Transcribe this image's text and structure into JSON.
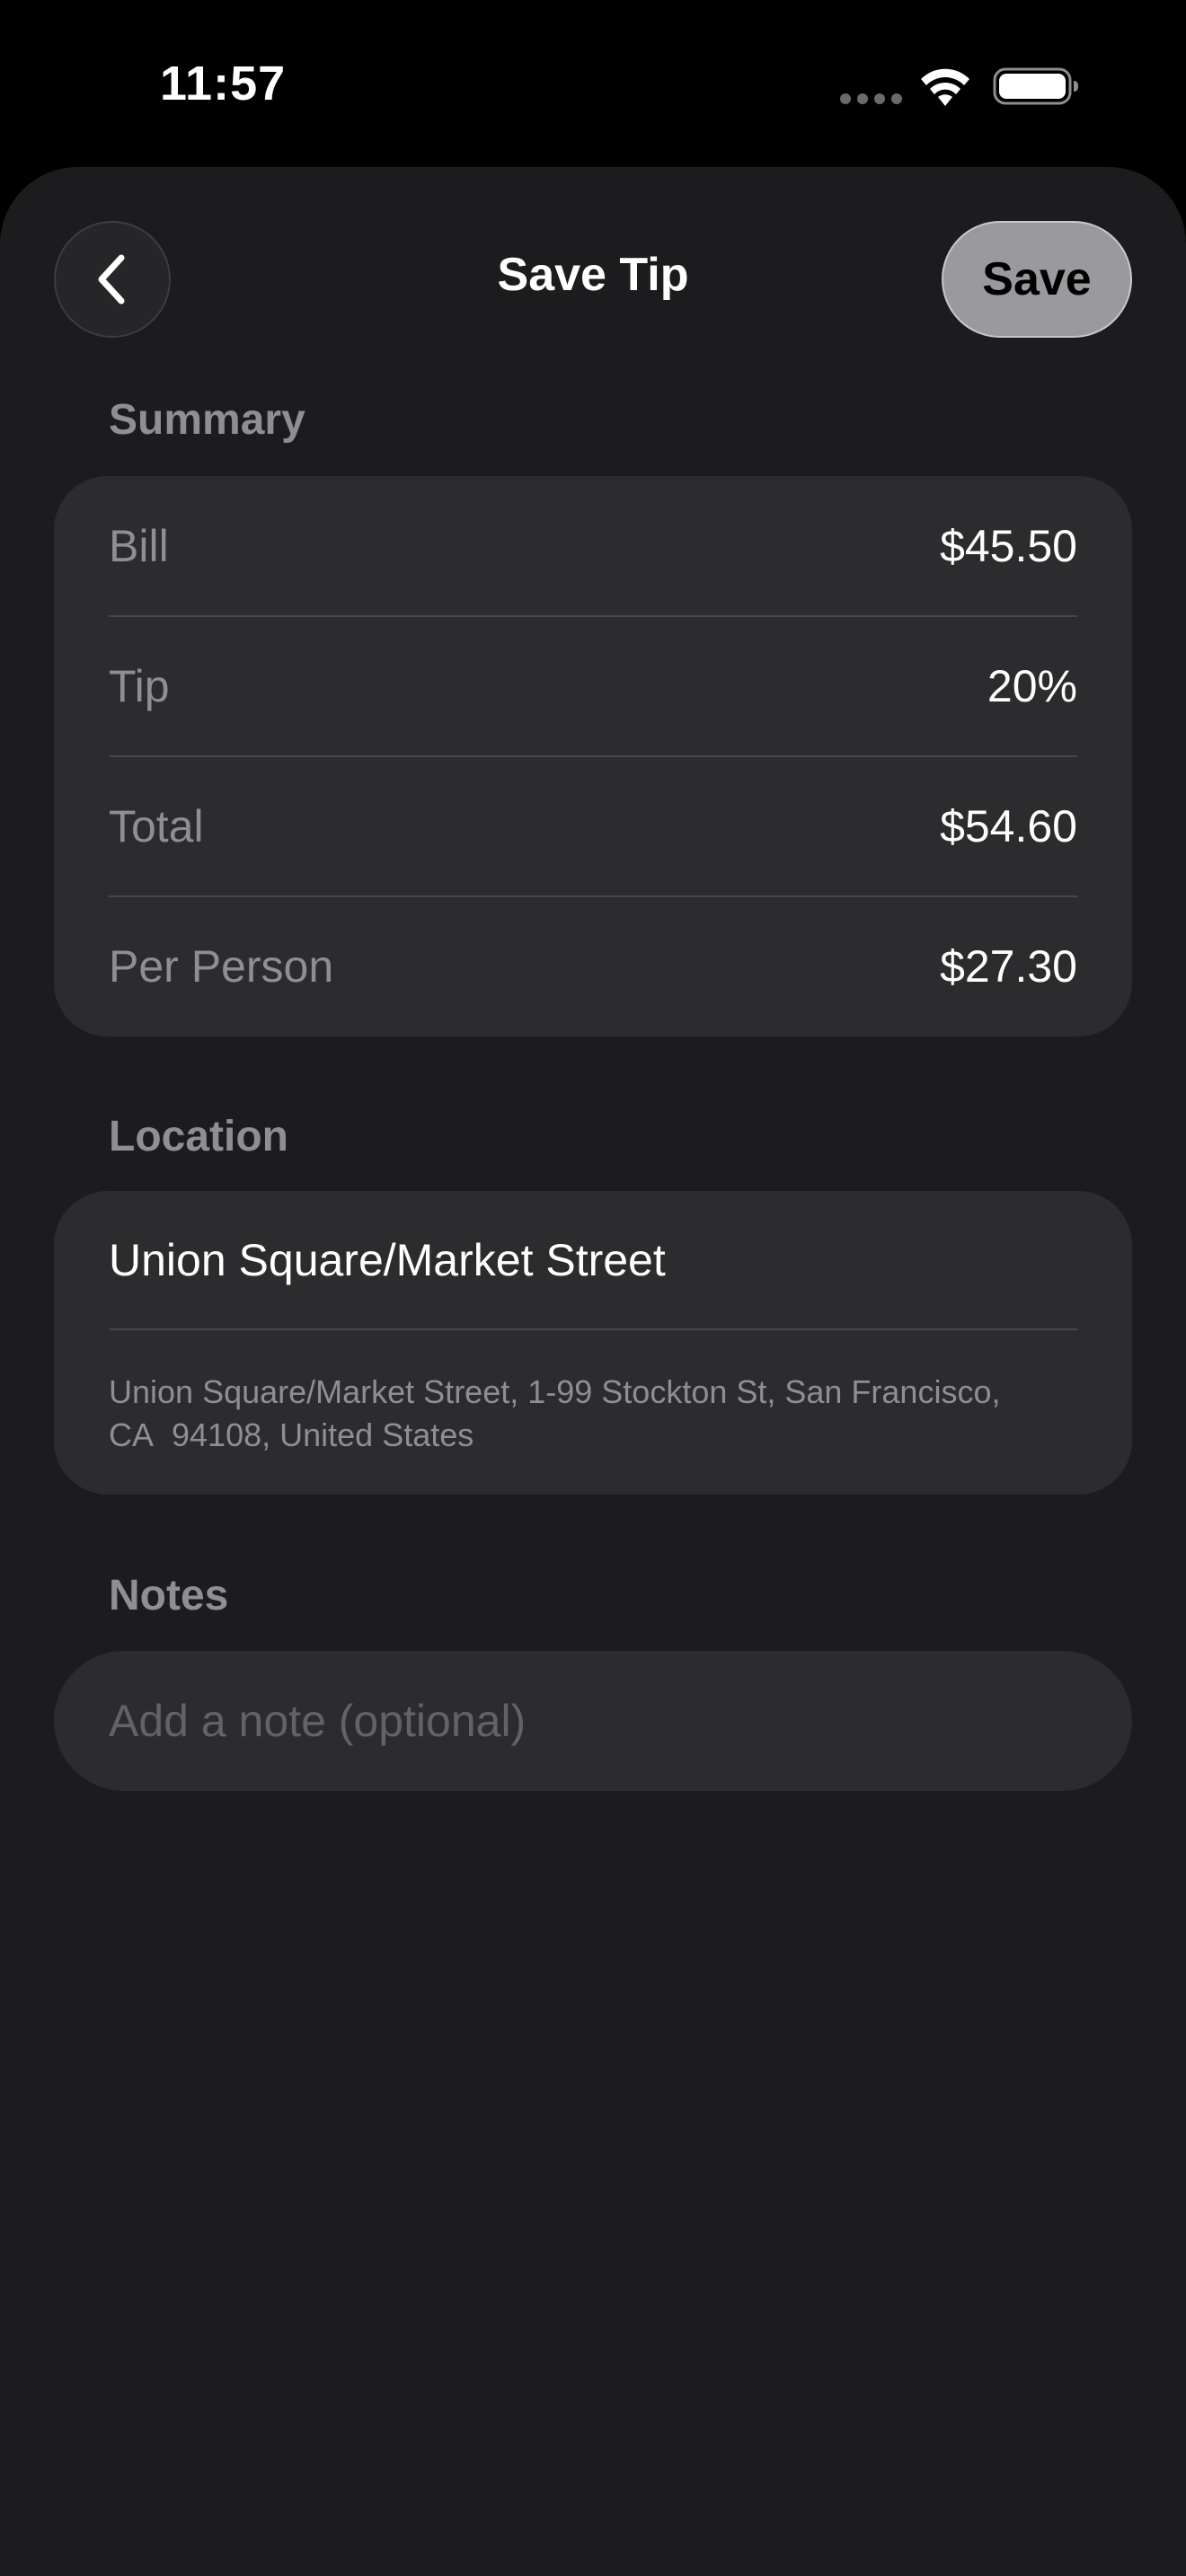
{
  "status_bar": {
    "time": "11:57",
    "icons": [
      "signal-dots-icon",
      "wifi-icon",
      "battery-icon"
    ]
  },
  "nav": {
    "back_icon": "chevron-left-icon",
    "title": "Save Tip",
    "save_label": "Save"
  },
  "summary": {
    "header": "Summary",
    "rows": [
      {
        "label": "Bill",
        "value": "$45.50"
      },
      {
        "label": "Tip",
        "value": "20%"
      },
      {
        "label": "Total",
        "value": "$54.60"
      },
      {
        "label": "Per Person",
        "value": "$27.30"
      }
    ]
  },
  "location": {
    "header": "Location",
    "name": "Union Square/Market Street",
    "address": "Union Square/Market Street, 1-99 Stockton St, San Francisco, CA  94108, United States"
  },
  "notes": {
    "header": "Notes",
    "value": "",
    "placeholder": "Add a note (optional)"
  },
  "colors": {
    "background": "#000000",
    "sheet": "#1c1c1e",
    "card": "#2c2c2e",
    "secondary_text": "#8e8e93",
    "save_button": "#9a9a9e"
  }
}
